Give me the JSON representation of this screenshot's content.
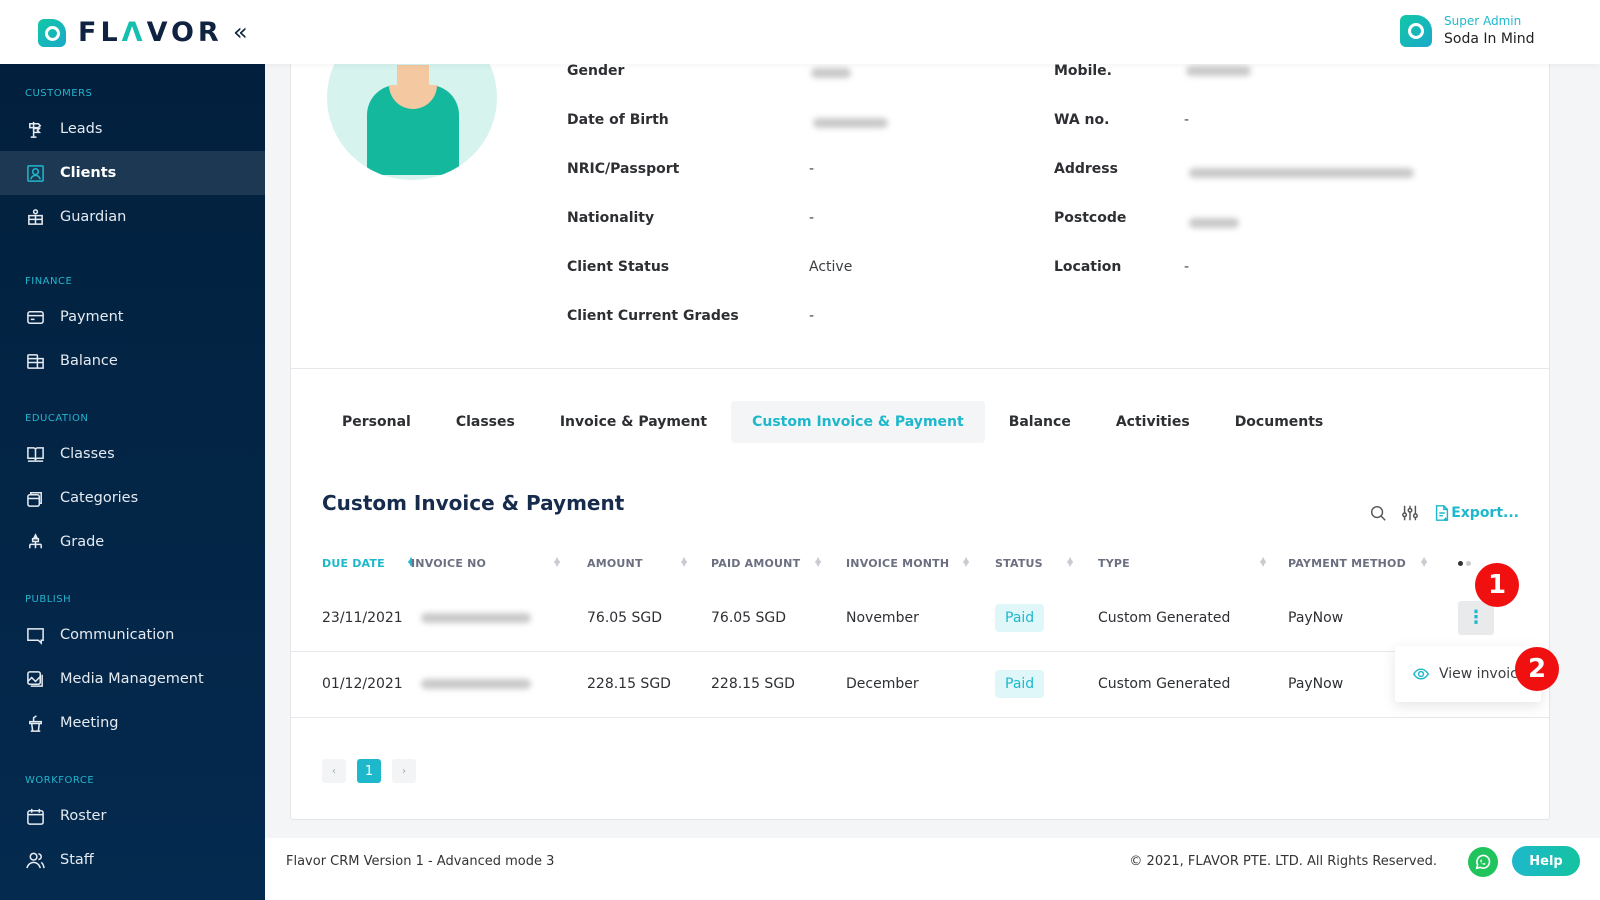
{
  "header": {
    "brand": "FLAVOR",
    "user_role": "Super Admin",
    "user_name": "Soda In Mind"
  },
  "sidebar": {
    "sections": [
      {
        "title": "CUSTOMERS",
        "items": [
          {
            "label": "Leads",
            "icon": "signpost-icon"
          },
          {
            "label": "Clients",
            "icon": "user-square-icon",
            "active": true
          },
          {
            "label": "Guardian",
            "icon": "guardian-icon"
          }
        ]
      },
      {
        "title": "FINANCE",
        "items": [
          {
            "label": "Payment",
            "icon": "credit-card-icon"
          },
          {
            "label": "Balance",
            "icon": "coins-icon"
          }
        ]
      },
      {
        "title": "EDUCATION",
        "items": [
          {
            "label": "Classes",
            "icon": "book-icon"
          },
          {
            "label": "Categories",
            "icon": "stack-icon"
          },
          {
            "label": "Grade",
            "icon": "hierarchy-icon"
          }
        ]
      },
      {
        "title": "PUBLISH",
        "items": [
          {
            "label": "Communication",
            "icon": "chat-icon"
          },
          {
            "label": "Media Management",
            "icon": "media-icon"
          },
          {
            "label": "Meeting",
            "icon": "podium-icon"
          }
        ]
      },
      {
        "title": "WORKFORCE",
        "items": [
          {
            "label": "Roster",
            "icon": "calendar-icon"
          },
          {
            "label": "Staff",
            "icon": "staff-icon"
          }
        ]
      }
    ]
  },
  "profile": {
    "left": [
      {
        "label": "Gender",
        "value": "",
        "blurred": true
      },
      {
        "label": "Date of Birth",
        "value": "",
        "blurred": true
      },
      {
        "label": "NRIC/Passport",
        "value": "-"
      },
      {
        "label": "Nationality",
        "value": "-"
      },
      {
        "label": "Client Status",
        "value": "Active"
      },
      {
        "label": "Client Current Grades",
        "value": "-"
      }
    ],
    "right": [
      {
        "label": "Mobile.",
        "value": "",
        "blurred": true
      },
      {
        "label": "WA no.",
        "value": "-"
      },
      {
        "label": "Address",
        "value": "",
        "blurred": true
      },
      {
        "label": "Postcode",
        "value": "",
        "blurred": true
      },
      {
        "label": "Location",
        "value": "-"
      }
    ]
  },
  "tabs": [
    {
      "label": "Personal"
    },
    {
      "label": "Classes"
    },
    {
      "label": "Invoice & Payment"
    },
    {
      "label": "Custom Invoice & Payment",
      "active": true
    },
    {
      "label": "Balance"
    },
    {
      "label": "Activities"
    },
    {
      "label": "Documents"
    }
  ],
  "section": {
    "title": "Custom Invoice & Payment",
    "export_label": "Export..."
  },
  "table": {
    "columns": [
      "DUE DATE",
      "INVOICE NO",
      "AMOUNT",
      "PAID AMOUNT",
      "INVOICE MONTH",
      "STATUS",
      "TYPE",
      "PAYMENT METHOD"
    ],
    "rows": [
      {
        "due_date": "23/11/2021",
        "invoice_no": "",
        "amount": "76.05 SGD",
        "paid_amount": "76.05 SGD",
        "month": "November",
        "status": "Paid",
        "type": "Custom Generated",
        "method": "PayNow"
      },
      {
        "due_date": "01/12/2021",
        "invoice_no": "",
        "amount": "228.15 SGD",
        "paid_amount": "228.15 SGD",
        "month": "December",
        "status": "Paid",
        "type": "Custom Generated",
        "method": "PayNow"
      }
    ]
  },
  "row_menu": {
    "view_invoice": "View invoice"
  },
  "markers": [
    "1",
    "2"
  ],
  "pagination": {
    "current": "1",
    "prev": "‹",
    "next": "›"
  },
  "footer": {
    "version": "Flavor CRM Version 1 - Advanced mode 3",
    "copyright": "© 2021, FLAVOR PTE. LTD. All Rights Reserved.",
    "help": "Help"
  },
  "colors": {
    "accent": "#1eb8cc",
    "sidebar": "#03213f",
    "marker": "#f01010"
  }
}
